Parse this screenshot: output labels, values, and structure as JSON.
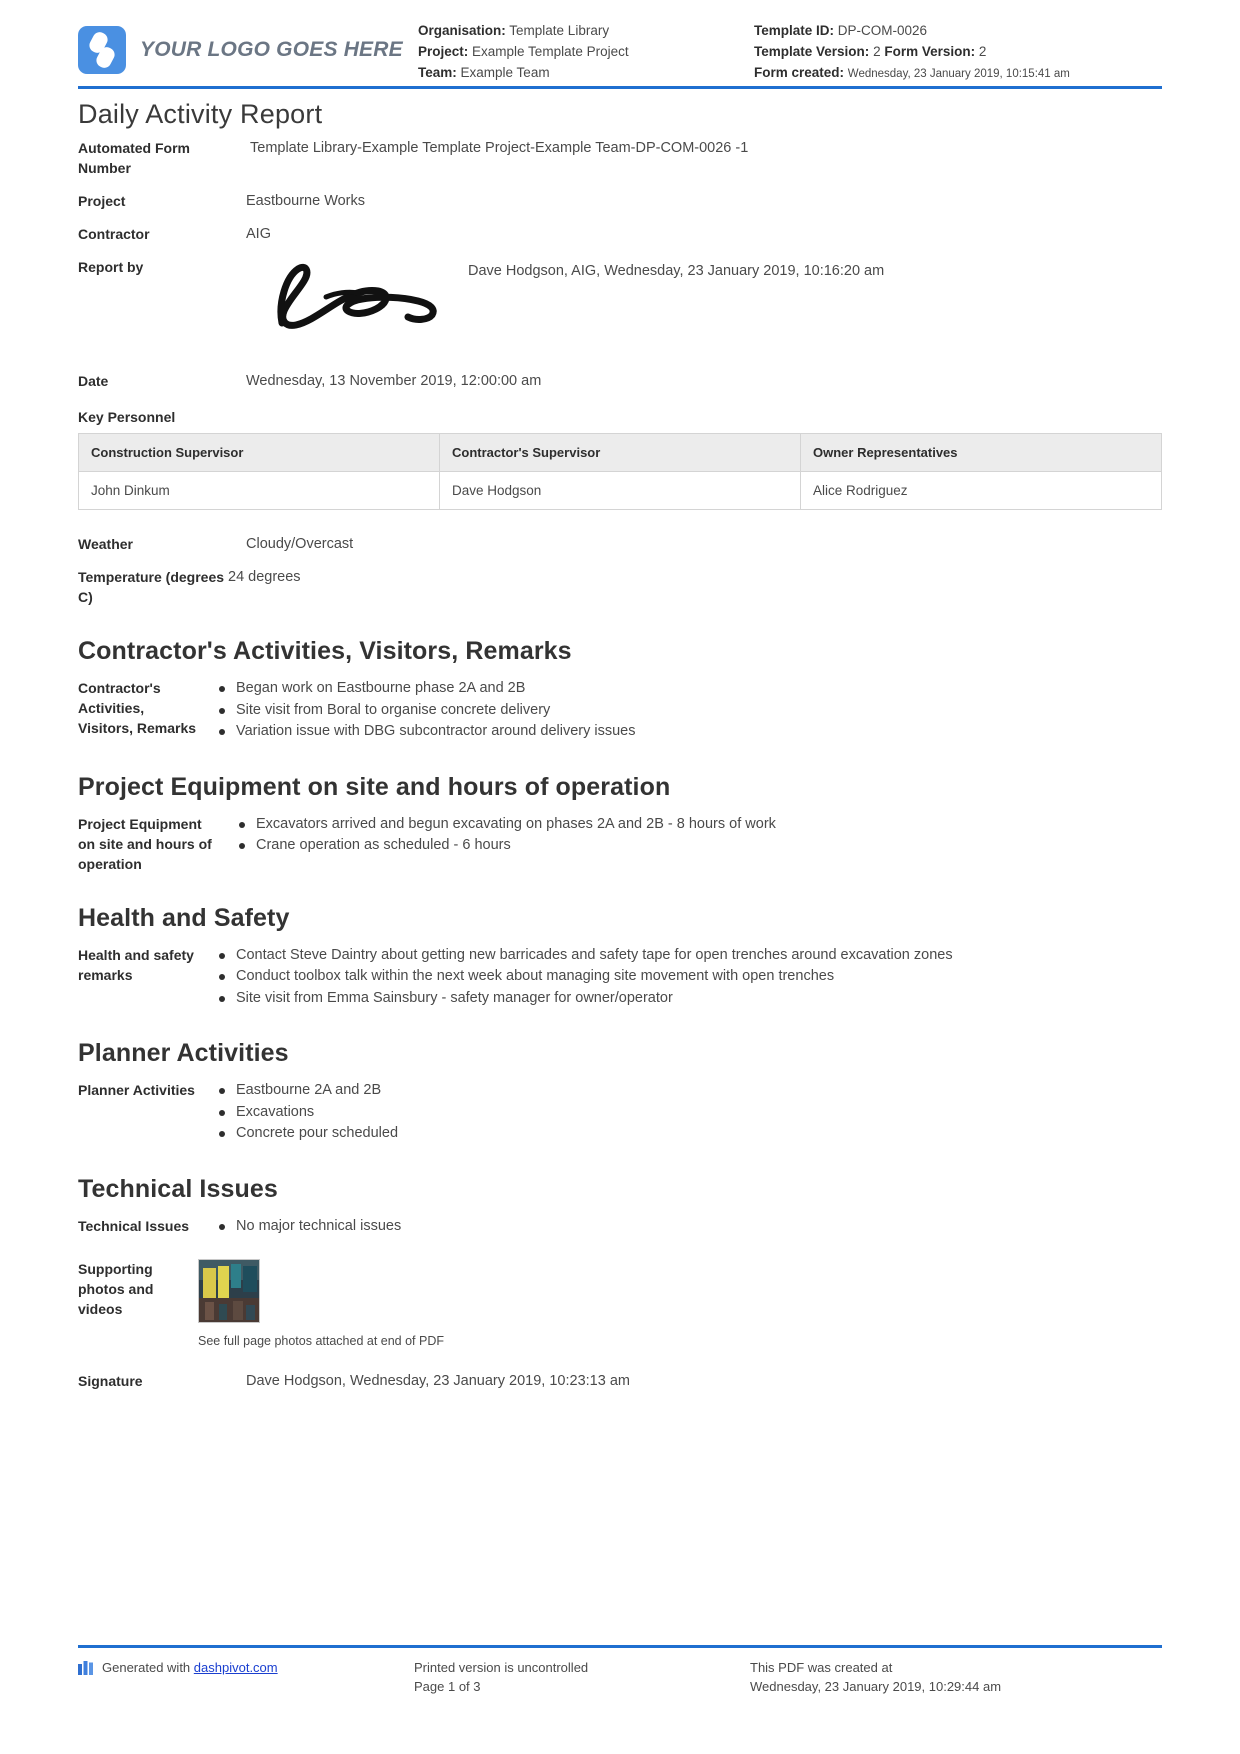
{
  "header": {
    "logo_text": "YOUR LOGO GOES HERE",
    "left": {
      "organisation_label": "Organisation:",
      "organisation_value": "Template Library",
      "project_label": "Project:",
      "project_value": "Example Template Project",
      "team_label": "Team:",
      "team_value": "Example Team"
    },
    "right": {
      "template_id_label": "Template ID:",
      "template_id_value": "DP-COM-0026",
      "template_version_label": "Template Version:",
      "template_version_value": "2",
      "form_version_label": "Form Version:",
      "form_version_value": "2",
      "form_created_label": "Form created:",
      "form_created_value": "Wednesday, 23 January 2019, 10:15:41 am"
    }
  },
  "title": "Daily Activity Report",
  "fields": {
    "automated_form_number_label": "Automated Form Number",
    "automated_form_number_value": "Template Library-Example Template Project-Example Team-DP-COM-0026   -1",
    "project_label": "Project",
    "project_value": "Eastbourne Works",
    "contractor_label": "Contractor",
    "contractor_value": "AIG",
    "report_by_label": "Report by",
    "report_by_value": "Dave Hodgson, AIG, Wednesday, 23 January 2019, 10:16:20 am",
    "date_label": "Date",
    "date_value": "Wednesday, 13 November 2019, 12:00:00 am",
    "weather_label": "Weather",
    "weather_value": "Cloudy/Overcast",
    "temperature_label": "Temperature (degrees C)",
    "temperature_value": "24 degrees"
  },
  "key_personnel": {
    "heading": "Key Personnel",
    "columns": [
      "Construction Supervisor",
      "Contractor's Supervisor",
      "Owner Representatives"
    ],
    "rows": [
      [
        "John Dinkum",
        "Dave Hodgson",
        "Alice Rodriguez"
      ]
    ]
  },
  "sections": [
    {
      "title": "Contractor's Activities, Visitors, Remarks",
      "label": "Contractor's Activities, Visitors, Remarks",
      "bullets": [
        "Began work on Eastbourne phase 2A and 2B",
        "Site visit from Boral to organise concrete delivery",
        "Variation issue with DBG subcontractor around delivery issues"
      ]
    },
    {
      "title": "Project Equipment on site and hours of operation",
      "label": "Project Equipment on site and hours of operation",
      "bullets": [
        "Excavators arrived and begun excavating on phases 2A and 2B - 8 hours of work",
        "Crane operation as scheduled - 6 hours"
      ]
    },
    {
      "title": "Health and Safety",
      "label": "Health and safety remarks",
      "bullets": [
        "Contact Steve Daintry about getting new barricades and safety tape for open trenches around excavation zones",
        "Conduct toolbox talk within the next week about managing site movement with open trenches",
        "Site visit from Emma Sainsbury - safety manager for owner/operator"
      ]
    },
    {
      "title": "Planner Activities",
      "label": "Planner Activities",
      "bullets": [
        "Eastbourne 2A and 2B",
        "Excavations",
        "Concrete pour scheduled"
      ]
    },
    {
      "title": "Technical Issues",
      "label": "Technical Issues",
      "bullets": [
        "No major technical issues"
      ]
    }
  ],
  "attachments": {
    "label": "Supporting photos and videos",
    "caption": "See full page photos attached at end of PDF"
  },
  "signature": {
    "label": "Signature",
    "value": "Dave Hodgson, Wednesday, 23 January 2019, 10:23:13 am"
  },
  "footer": {
    "generated_prefix": "Generated with",
    "generated_link": "dashpivot.com",
    "uncontrolled": "Printed version is uncontrolled",
    "page": "Page 1 of 3",
    "created_line1": "This PDF was created at",
    "created_line2": "Wednesday, 23 January 2019, 10:29:44 am"
  },
  "colors": {
    "accent_blue": "#1f6fd0",
    "logo_blue": "#4a90e2",
    "link_blue": "#1a3fd0"
  }
}
